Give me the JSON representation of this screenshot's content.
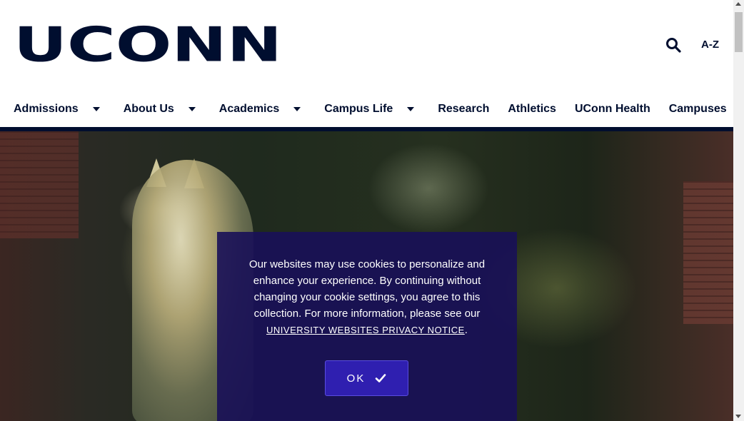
{
  "header": {
    "logo_text": "UCONN",
    "search_icon": "search-icon",
    "az_label": "A-Z"
  },
  "nav": {
    "items": [
      {
        "label": "Admissions",
        "has_dropdown": true
      },
      {
        "label": "About Us",
        "has_dropdown": true
      },
      {
        "label": "Academics",
        "has_dropdown": true
      },
      {
        "label": "Campus Life",
        "has_dropdown": true
      },
      {
        "label": "Research",
        "has_dropdown": false
      },
      {
        "label": "Athletics",
        "has_dropdown": false
      },
      {
        "label": "UConn Health",
        "has_dropdown": false
      },
      {
        "label": "Campuses",
        "has_dropdown": false
      }
    ]
  },
  "cookie_banner": {
    "message": "Our websites may use cookies to personalize and enhance your experience. By continuing without changing your cookie settings, you agree to this collection. For more information, please see our",
    "link_text": "UNIVERSITY WEBSITES PRIVACY NOTICE",
    "after_link": ".",
    "ok_label": "OK",
    "ok_icon": "checkmark-icon"
  },
  "colors": {
    "brand_navy": "#000e2f",
    "cookie_bg": "#181058",
    "ok_button": "#2f1fb0"
  }
}
